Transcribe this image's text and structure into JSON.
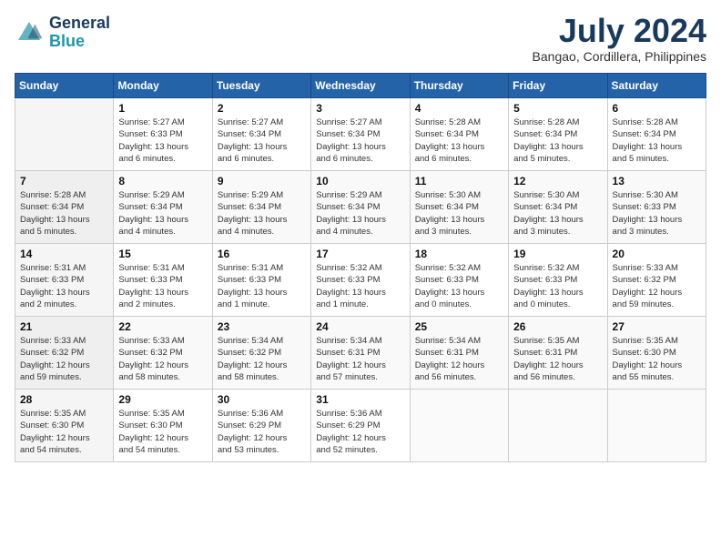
{
  "header": {
    "logo_line1": "General",
    "logo_line2": "Blue",
    "month": "July 2024",
    "location": "Bangao, Cordillera, Philippines"
  },
  "columns": [
    "Sunday",
    "Monday",
    "Tuesday",
    "Wednesday",
    "Thursday",
    "Friday",
    "Saturday"
  ],
  "weeks": [
    [
      {
        "day": "",
        "info": ""
      },
      {
        "day": "1",
        "info": "Sunrise: 5:27 AM\nSunset: 6:33 PM\nDaylight: 13 hours\nand 6 minutes."
      },
      {
        "day": "2",
        "info": "Sunrise: 5:27 AM\nSunset: 6:34 PM\nDaylight: 13 hours\nand 6 minutes."
      },
      {
        "day": "3",
        "info": "Sunrise: 5:27 AM\nSunset: 6:34 PM\nDaylight: 13 hours\nand 6 minutes."
      },
      {
        "day": "4",
        "info": "Sunrise: 5:28 AM\nSunset: 6:34 PM\nDaylight: 13 hours\nand 6 minutes."
      },
      {
        "day": "5",
        "info": "Sunrise: 5:28 AM\nSunset: 6:34 PM\nDaylight: 13 hours\nand 5 minutes."
      },
      {
        "day": "6",
        "info": "Sunrise: 5:28 AM\nSunset: 6:34 PM\nDaylight: 13 hours\nand 5 minutes."
      }
    ],
    [
      {
        "day": "7",
        "info": "Sunrise: 5:28 AM\nSunset: 6:34 PM\nDaylight: 13 hours\nand 5 minutes."
      },
      {
        "day": "8",
        "info": "Sunrise: 5:29 AM\nSunset: 6:34 PM\nDaylight: 13 hours\nand 4 minutes."
      },
      {
        "day": "9",
        "info": "Sunrise: 5:29 AM\nSunset: 6:34 PM\nDaylight: 13 hours\nand 4 minutes."
      },
      {
        "day": "10",
        "info": "Sunrise: 5:29 AM\nSunset: 6:34 PM\nDaylight: 13 hours\nand 4 minutes."
      },
      {
        "day": "11",
        "info": "Sunrise: 5:30 AM\nSunset: 6:34 PM\nDaylight: 13 hours\nand 3 minutes."
      },
      {
        "day": "12",
        "info": "Sunrise: 5:30 AM\nSunset: 6:34 PM\nDaylight: 13 hours\nand 3 minutes."
      },
      {
        "day": "13",
        "info": "Sunrise: 5:30 AM\nSunset: 6:33 PM\nDaylight: 13 hours\nand 3 minutes."
      }
    ],
    [
      {
        "day": "14",
        "info": "Sunrise: 5:31 AM\nSunset: 6:33 PM\nDaylight: 13 hours\nand 2 minutes."
      },
      {
        "day": "15",
        "info": "Sunrise: 5:31 AM\nSunset: 6:33 PM\nDaylight: 13 hours\nand 2 minutes."
      },
      {
        "day": "16",
        "info": "Sunrise: 5:31 AM\nSunset: 6:33 PM\nDaylight: 13 hours\nand 1 minute."
      },
      {
        "day": "17",
        "info": "Sunrise: 5:32 AM\nSunset: 6:33 PM\nDaylight: 13 hours\nand 1 minute."
      },
      {
        "day": "18",
        "info": "Sunrise: 5:32 AM\nSunset: 6:33 PM\nDaylight: 13 hours\nand 0 minutes."
      },
      {
        "day": "19",
        "info": "Sunrise: 5:32 AM\nSunset: 6:33 PM\nDaylight: 13 hours\nand 0 minutes."
      },
      {
        "day": "20",
        "info": "Sunrise: 5:33 AM\nSunset: 6:32 PM\nDaylight: 12 hours\nand 59 minutes."
      }
    ],
    [
      {
        "day": "21",
        "info": "Sunrise: 5:33 AM\nSunset: 6:32 PM\nDaylight: 12 hours\nand 59 minutes."
      },
      {
        "day": "22",
        "info": "Sunrise: 5:33 AM\nSunset: 6:32 PM\nDaylight: 12 hours\nand 58 minutes."
      },
      {
        "day": "23",
        "info": "Sunrise: 5:34 AM\nSunset: 6:32 PM\nDaylight: 12 hours\nand 58 minutes."
      },
      {
        "day": "24",
        "info": "Sunrise: 5:34 AM\nSunset: 6:31 PM\nDaylight: 12 hours\nand 57 minutes."
      },
      {
        "day": "25",
        "info": "Sunrise: 5:34 AM\nSunset: 6:31 PM\nDaylight: 12 hours\nand 56 minutes."
      },
      {
        "day": "26",
        "info": "Sunrise: 5:35 AM\nSunset: 6:31 PM\nDaylight: 12 hours\nand 56 minutes."
      },
      {
        "day": "27",
        "info": "Sunrise: 5:35 AM\nSunset: 6:30 PM\nDaylight: 12 hours\nand 55 minutes."
      }
    ],
    [
      {
        "day": "28",
        "info": "Sunrise: 5:35 AM\nSunset: 6:30 PM\nDaylight: 12 hours\nand 54 minutes."
      },
      {
        "day": "29",
        "info": "Sunrise: 5:35 AM\nSunset: 6:30 PM\nDaylight: 12 hours\nand 54 minutes."
      },
      {
        "day": "30",
        "info": "Sunrise: 5:36 AM\nSunset: 6:29 PM\nDaylight: 12 hours\nand 53 minutes."
      },
      {
        "day": "31",
        "info": "Sunrise: 5:36 AM\nSunset: 6:29 PM\nDaylight: 12 hours\nand 52 minutes."
      },
      {
        "day": "",
        "info": ""
      },
      {
        "day": "",
        "info": ""
      },
      {
        "day": "",
        "info": ""
      }
    ]
  ]
}
